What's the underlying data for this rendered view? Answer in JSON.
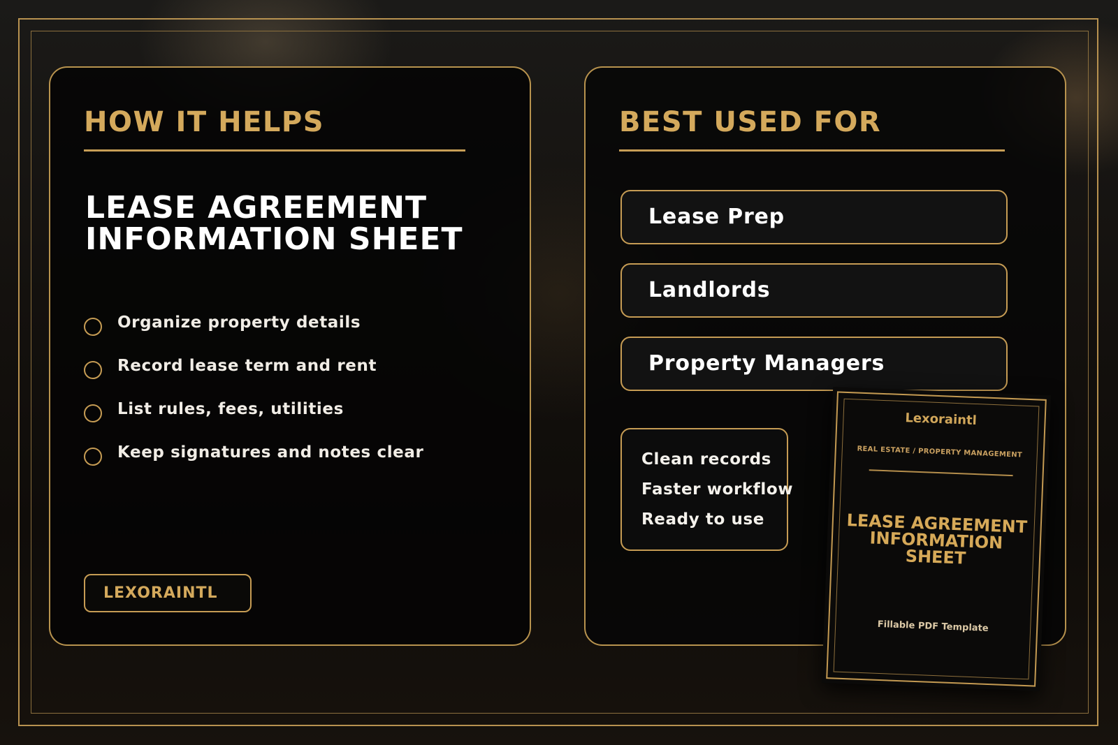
{
  "left_panel": {
    "heading": "HOW IT HELPS",
    "title_line1": "LEASE AGREEMENT",
    "title_line2": "INFORMATION SHEET",
    "benefits": [
      "Organize property details",
      "Record lease term and rent",
      "List rules, fees, utilities",
      "Keep signatures and notes clear"
    ],
    "brand_badge": "LEXORAINTL"
  },
  "right_panel": {
    "heading": "BEST USED FOR",
    "use_cases": [
      "Lease Prep",
      "Landlords",
      "Property Managers"
    ],
    "features": [
      "Clean records",
      "Faster workflow",
      "Ready to use"
    ]
  },
  "preview": {
    "brand": "Lexoraintl",
    "category": "REAL ESTATE / PROPERTY MANAGEMENT",
    "title_lines": [
      "LEASE AGREEMENT",
      "INFORMATION",
      "SHEET"
    ],
    "footer": "Fillable PDF Template"
  },
  "colors": {
    "gold": "#d4a95c",
    "panel_border": "#b8934e",
    "text_white": "#ffffff"
  }
}
